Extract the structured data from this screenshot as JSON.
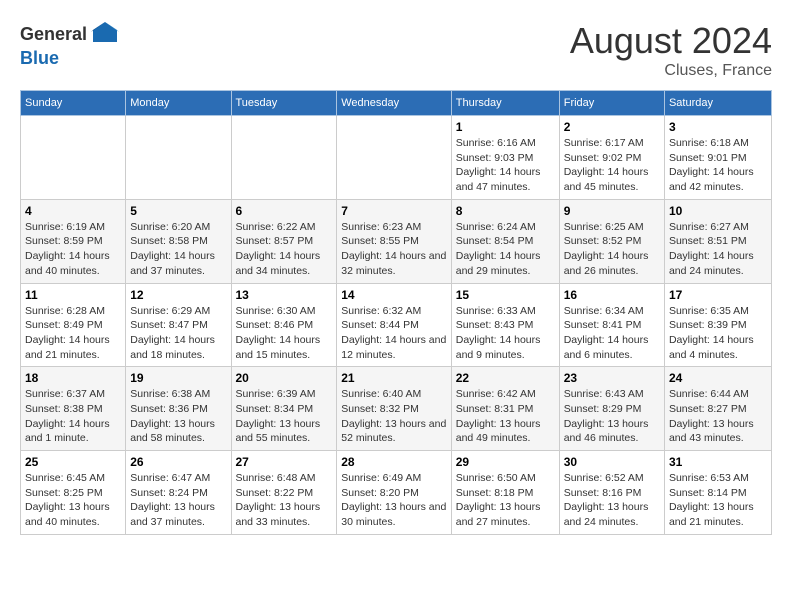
{
  "header": {
    "logo_general": "General",
    "logo_blue": "Blue",
    "month_year": "August 2024",
    "location": "Cluses, France"
  },
  "days_of_week": [
    "Sunday",
    "Monday",
    "Tuesday",
    "Wednesday",
    "Thursday",
    "Friday",
    "Saturday"
  ],
  "weeks": [
    [
      {
        "day": "",
        "sunrise": "",
        "sunset": "",
        "daylight": ""
      },
      {
        "day": "",
        "sunrise": "",
        "sunset": "",
        "daylight": ""
      },
      {
        "day": "",
        "sunrise": "",
        "sunset": "",
        "daylight": ""
      },
      {
        "day": "",
        "sunrise": "",
        "sunset": "",
        "daylight": ""
      },
      {
        "day": "1",
        "sunrise": "Sunrise: 6:16 AM",
        "sunset": "Sunset: 9:03 PM",
        "daylight": "Daylight: 14 hours and 47 minutes."
      },
      {
        "day": "2",
        "sunrise": "Sunrise: 6:17 AM",
        "sunset": "Sunset: 9:02 PM",
        "daylight": "Daylight: 14 hours and 45 minutes."
      },
      {
        "day": "3",
        "sunrise": "Sunrise: 6:18 AM",
        "sunset": "Sunset: 9:01 PM",
        "daylight": "Daylight: 14 hours and 42 minutes."
      }
    ],
    [
      {
        "day": "4",
        "sunrise": "Sunrise: 6:19 AM",
        "sunset": "Sunset: 8:59 PM",
        "daylight": "Daylight: 14 hours and 40 minutes."
      },
      {
        "day": "5",
        "sunrise": "Sunrise: 6:20 AM",
        "sunset": "Sunset: 8:58 PM",
        "daylight": "Daylight: 14 hours and 37 minutes."
      },
      {
        "day": "6",
        "sunrise": "Sunrise: 6:22 AM",
        "sunset": "Sunset: 8:57 PM",
        "daylight": "Daylight: 14 hours and 34 minutes."
      },
      {
        "day": "7",
        "sunrise": "Sunrise: 6:23 AM",
        "sunset": "Sunset: 8:55 PM",
        "daylight": "Daylight: 14 hours and 32 minutes."
      },
      {
        "day": "8",
        "sunrise": "Sunrise: 6:24 AM",
        "sunset": "Sunset: 8:54 PM",
        "daylight": "Daylight: 14 hours and 29 minutes."
      },
      {
        "day": "9",
        "sunrise": "Sunrise: 6:25 AM",
        "sunset": "Sunset: 8:52 PM",
        "daylight": "Daylight: 14 hours and 26 minutes."
      },
      {
        "day": "10",
        "sunrise": "Sunrise: 6:27 AM",
        "sunset": "Sunset: 8:51 PM",
        "daylight": "Daylight: 14 hours and 24 minutes."
      }
    ],
    [
      {
        "day": "11",
        "sunrise": "Sunrise: 6:28 AM",
        "sunset": "Sunset: 8:49 PM",
        "daylight": "Daylight: 14 hours and 21 minutes."
      },
      {
        "day": "12",
        "sunrise": "Sunrise: 6:29 AM",
        "sunset": "Sunset: 8:47 PM",
        "daylight": "Daylight: 14 hours and 18 minutes."
      },
      {
        "day": "13",
        "sunrise": "Sunrise: 6:30 AM",
        "sunset": "Sunset: 8:46 PM",
        "daylight": "Daylight: 14 hours and 15 minutes."
      },
      {
        "day": "14",
        "sunrise": "Sunrise: 6:32 AM",
        "sunset": "Sunset: 8:44 PM",
        "daylight": "Daylight: 14 hours and 12 minutes."
      },
      {
        "day": "15",
        "sunrise": "Sunrise: 6:33 AM",
        "sunset": "Sunset: 8:43 PM",
        "daylight": "Daylight: 14 hours and 9 minutes."
      },
      {
        "day": "16",
        "sunrise": "Sunrise: 6:34 AM",
        "sunset": "Sunset: 8:41 PM",
        "daylight": "Daylight: 14 hours and 6 minutes."
      },
      {
        "day": "17",
        "sunrise": "Sunrise: 6:35 AM",
        "sunset": "Sunset: 8:39 PM",
        "daylight": "Daylight: 14 hours and 4 minutes."
      }
    ],
    [
      {
        "day": "18",
        "sunrise": "Sunrise: 6:37 AM",
        "sunset": "Sunset: 8:38 PM",
        "daylight": "Daylight: 14 hours and 1 minute."
      },
      {
        "day": "19",
        "sunrise": "Sunrise: 6:38 AM",
        "sunset": "Sunset: 8:36 PM",
        "daylight": "Daylight: 13 hours and 58 minutes."
      },
      {
        "day": "20",
        "sunrise": "Sunrise: 6:39 AM",
        "sunset": "Sunset: 8:34 PM",
        "daylight": "Daylight: 13 hours and 55 minutes."
      },
      {
        "day": "21",
        "sunrise": "Sunrise: 6:40 AM",
        "sunset": "Sunset: 8:32 PM",
        "daylight": "Daylight: 13 hours and 52 minutes."
      },
      {
        "day": "22",
        "sunrise": "Sunrise: 6:42 AM",
        "sunset": "Sunset: 8:31 PM",
        "daylight": "Daylight: 13 hours and 49 minutes."
      },
      {
        "day": "23",
        "sunrise": "Sunrise: 6:43 AM",
        "sunset": "Sunset: 8:29 PM",
        "daylight": "Daylight: 13 hours and 46 minutes."
      },
      {
        "day": "24",
        "sunrise": "Sunrise: 6:44 AM",
        "sunset": "Sunset: 8:27 PM",
        "daylight": "Daylight: 13 hours and 43 minutes."
      }
    ],
    [
      {
        "day": "25",
        "sunrise": "Sunrise: 6:45 AM",
        "sunset": "Sunset: 8:25 PM",
        "daylight": "Daylight: 13 hours and 40 minutes."
      },
      {
        "day": "26",
        "sunrise": "Sunrise: 6:47 AM",
        "sunset": "Sunset: 8:24 PM",
        "daylight": "Daylight: 13 hours and 37 minutes."
      },
      {
        "day": "27",
        "sunrise": "Sunrise: 6:48 AM",
        "sunset": "Sunset: 8:22 PM",
        "daylight": "Daylight: 13 hours and 33 minutes."
      },
      {
        "day": "28",
        "sunrise": "Sunrise: 6:49 AM",
        "sunset": "Sunset: 8:20 PM",
        "daylight": "Daylight: 13 hours and 30 minutes."
      },
      {
        "day": "29",
        "sunrise": "Sunrise: 6:50 AM",
        "sunset": "Sunset: 8:18 PM",
        "daylight": "Daylight: 13 hours and 27 minutes."
      },
      {
        "day": "30",
        "sunrise": "Sunrise: 6:52 AM",
        "sunset": "Sunset: 8:16 PM",
        "daylight": "Daylight: 13 hours and 24 minutes."
      },
      {
        "day": "31",
        "sunrise": "Sunrise: 6:53 AM",
        "sunset": "Sunset: 8:14 PM",
        "daylight": "Daylight: 13 hours and 21 minutes."
      }
    ]
  ]
}
